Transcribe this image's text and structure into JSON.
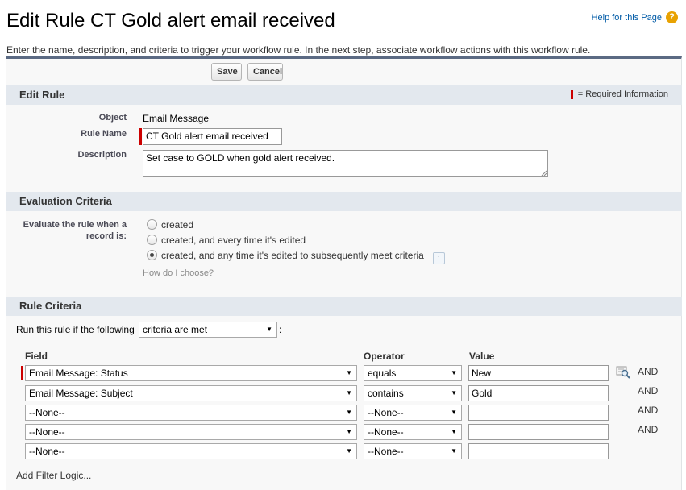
{
  "page": {
    "title": "Edit Rule CT Gold alert email received",
    "help_link": "Help for this Page",
    "help_icon": "question-circle-icon",
    "intro": "Enter the name, description, and criteria to trigger your workflow rule. In the next step, associate workflow actions with this workflow rule."
  },
  "buttons": {
    "save": "Save",
    "cancel": "Cancel"
  },
  "edit_rule": {
    "title": "Edit Rule",
    "required_legend": "= Required Information",
    "object_label": "Object",
    "object_value": "Email Message",
    "rule_name_label": "Rule Name",
    "rule_name_value": "CT Gold alert email received",
    "description_label": "Description",
    "description_value": "Set case to GOLD when gold alert received."
  },
  "evaluation": {
    "title": "Evaluation Criteria",
    "label_line1": "Evaluate the rule when a",
    "label_line2": "record is:",
    "options": [
      {
        "label": "created",
        "checked": false
      },
      {
        "label": "created, and every time it's edited",
        "checked": false
      },
      {
        "label": "created, and any time it's edited to subsequently meet criteria",
        "checked": true
      }
    ],
    "info_icon": "info-icon",
    "how_link": "How do I choose?"
  },
  "rule_criteria": {
    "title": "Rule Criteria",
    "run_prefix": "Run this rule if the following",
    "run_select": "criteria are met",
    "run_suffix": ":",
    "headers": {
      "field": "Field",
      "operator": "Operator",
      "value": "Value"
    },
    "rows": [
      {
        "field": "Email Message: Status",
        "operator": "equals",
        "value": "New",
        "and": "AND",
        "required": true,
        "lookup": true
      },
      {
        "field": "Email Message: Subject",
        "operator": "contains",
        "value": "Gold",
        "and": "AND",
        "required": false,
        "lookup": false
      },
      {
        "field": "--None--",
        "operator": "--None--",
        "value": "",
        "and": "AND",
        "required": false,
        "lookup": false
      },
      {
        "field": "--None--",
        "operator": "--None--",
        "value": "",
        "and": "AND",
        "required": false,
        "lookup": false
      },
      {
        "field": "--None--",
        "operator": "--None--",
        "value": "",
        "and": "",
        "required": false,
        "lookup": false
      }
    ],
    "add_filter_link": "Add Filter Logic..."
  },
  "colors": {
    "header_border": "#5b6a83",
    "section_bg": "#e3e8ee",
    "required": "#cc0000",
    "help_link": "#015ba7"
  }
}
